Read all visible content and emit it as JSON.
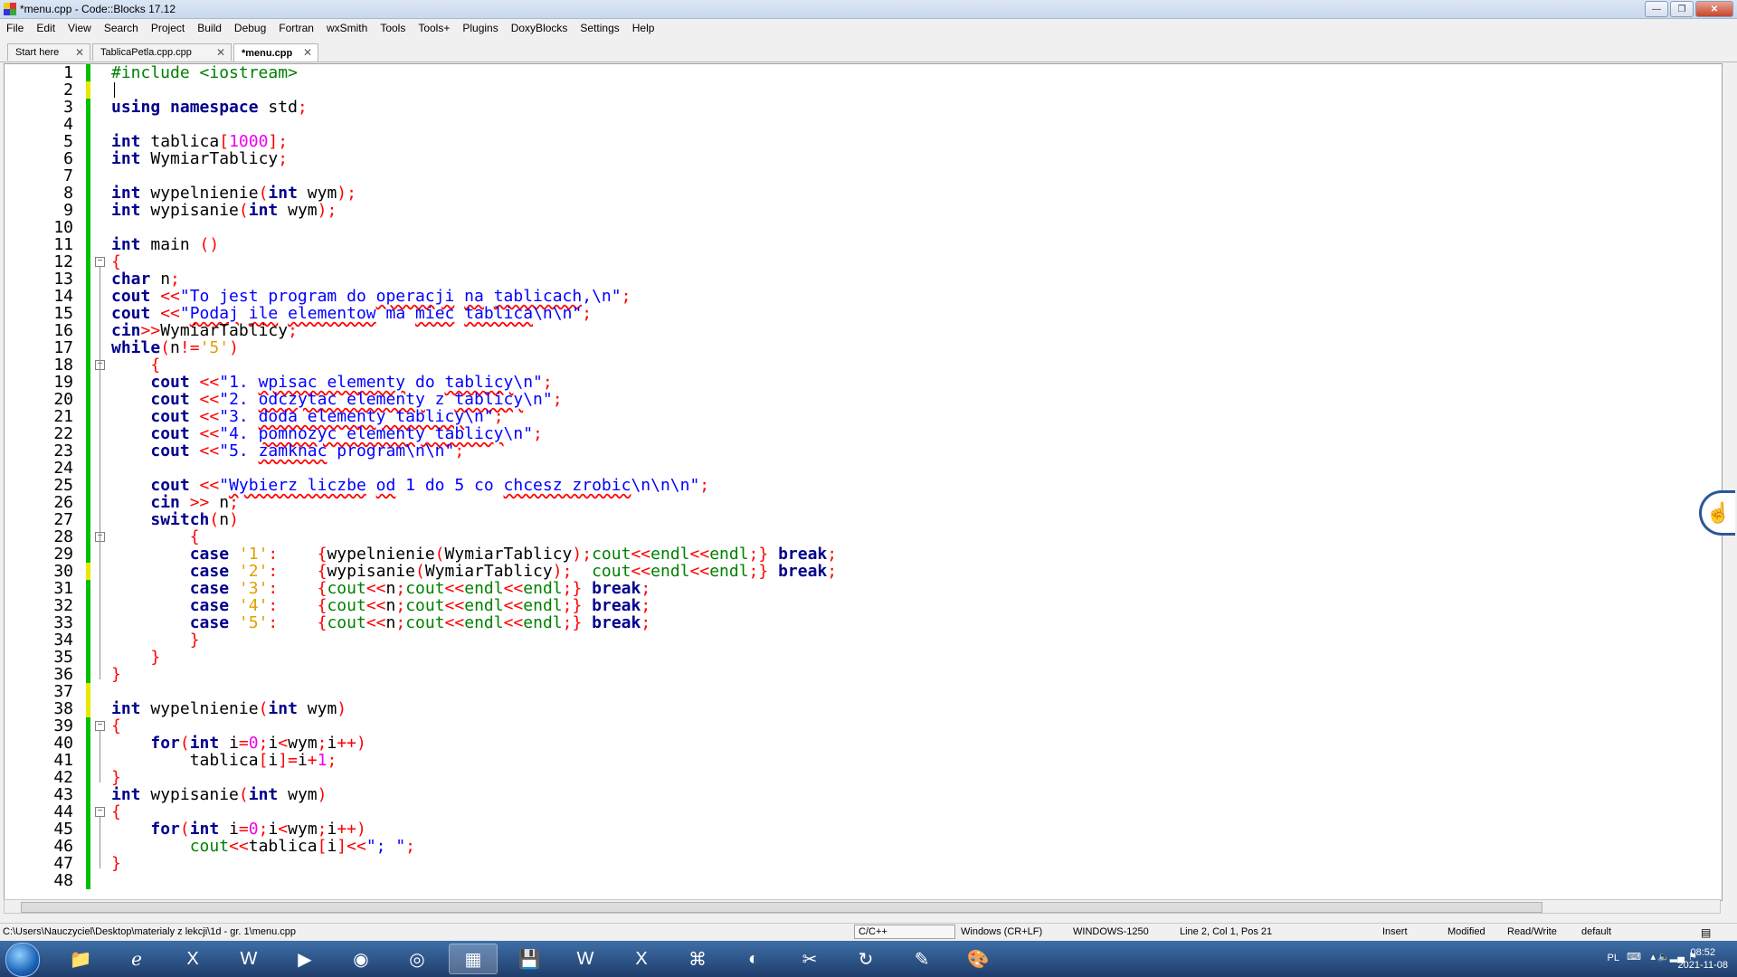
{
  "window": {
    "title": "*menu.cpp - Code::Blocks 17.12",
    "controls": {
      "minimize": "—",
      "maximize": "❐",
      "close": "✕"
    }
  },
  "menubar": [
    "File",
    "Edit",
    "View",
    "Search",
    "Project",
    "Build",
    "Debug",
    "Fortran",
    "wxSmith",
    "Tools",
    "Tools+",
    "Plugins",
    "DoxyBlocks",
    "Settings",
    "Help"
  ],
  "tabs": [
    {
      "label": "Start here",
      "active": false
    },
    {
      "label": "TablicaPetla.cpp.cpp",
      "active": false
    },
    {
      "label": "*menu.cpp",
      "active": true
    }
  ],
  "editor": {
    "line_numbers": [
      "1",
      "2",
      "3",
      "4",
      "5",
      "6",
      "7",
      "8",
      "9",
      "10",
      "11",
      "12",
      "13",
      "14",
      "15",
      "16",
      "17",
      "18",
      "19",
      "20",
      "21",
      "22",
      "23",
      "24",
      "25",
      "26",
      "27",
      "28",
      "29",
      "30",
      "31",
      "32",
      "33",
      "34",
      "35",
      "36",
      "37",
      "38",
      "39",
      "40",
      "41",
      "42",
      "43",
      "44",
      "45",
      "46",
      "47",
      "48"
    ],
    "lines": [
      [
        [
          "pp",
          "#include <iostream>"
        ]
      ],
      [],
      [
        [
          "kw",
          "using namespace "
        ],
        [
          "pl",
          "std"
        ],
        [
          "op",
          ";"
        ]
      ],
      [],
      [
        [
          "kw",
          "int "
        ],
        [
          "pl",
          "tablica"
        ],
        [
          "op",
          "["
        ],
        [
          "num",
          "1000"
        ],
        [
          "op",
          "];"
        ]
      ],
      [
        [
          "kw",
          "int "
        ],
        [
          "pl",
          "WymiarTablicy"
        ],
        [
          "op",
          ";"
        ]
      ],
      [],
      [
        [
          "kw",
          "int "
        ],
        [
          "pl",
          "wypelnienie"
        ],
        [
          "op",
          "("
        ],
        [
          "kw",
          "int "
        ],
        [
          "pl",
          "wym"
        ],
        [
          "op",
          ");"
        ]
      ],
      [
        [
          "kw",
          "int "
        ],
        [
          "pl",
          "wypisanie"
        ],
        [
          "op",
          "("
        ],
        [
          "kw",
          "int "
        ],
        [
          "pl",
          "wym"
        ],
        [
          "op",
          ");"
        ]
      ],
      [],
      [
        [
          "kw",
          "int "
        ],
        [
          "pl",
          "main "
        ],
        [
          "op",
          "()"
        ]
      ],
      [
        [
          "op",
          "{"
        ]
      ],
      [
        [
          "kw",
          "char "
        ],
        [
          "pl",
          "n"
        ],
        [
          "op",
          ";"
        ]
      ],
      [
        [
          "kw",
          "cout "
        ],
        [
          "op",
          "<<"
        ],
        [
          "str",
          "\"To jest program do "
        ],
        [
          "str sq",
          "operacji"
        ],
        [
          "str",
          " "
        ],
        [
          "str sq",
          "na"
        ],
        [
          "str",
          " "
        ],
        [
          "str sq",
          "tablicach"
        ],
        [
          "str",
          ",\\n\""
        ],
        [
          "op",
          ";"
        ]
      ],
      [
        [
          "kw",
          "cout "
        ],
        [
          "op",
          "<<"
        ],
        [
          "str",
          "\""
        ],
        [
          "str sq",
          "Podaj"
        ],
        [
          "str",
          " "
        ],
        [
          "str sq",
          "ile"
        ],
        [
          "str",
          " "
        ],
        [
          "str sq",
          "elementow"
        ],
        [
          "str",
          " ma "
        ],
        [
          "str sq",
          "miec"
        ],
        [
          "str",
          " "
        ],
        [
          "str sq",
          "tablica"
        ],
        [
          "str",
          "\\n\\n\""
        ],
        [
          "op",
          ";"
        ]
      ],
      [
        [
          "kw",
          "cin"
        ],
        [
          "op",
          ">>"
        ],
        [
          "pl",
          "WymiarTablicy"
        ],
        [
          "op",
          ";"
        ]
      ],
      [
        [
          "kw",
          "while"
        ],
        [
          "op",
          "("
        ],
        [
          "pl",
          "n"
        ],
        [
          "op",
          "!="
        ],
        [
          "chr",
          "'5'"
        ],
        [
          "op",
          ")"
        ]
      ],
      [
        [
          "pl",
          "    "
        ],
        [
          "op",
          "{"
        ]
      ],
      [
        [
          "pl",
          "    "
        ],
        [
          "kw",
          "cout "
        ],
        [
          "op",
          "<<"
        ],
        [
          "str",
          "\"1. "
        ],
        [
          "str sq",
          "wpisac elementy"
        ],
        [
          "str",
          " do "
        ],
        [
          "str sq",
          "tablicy"
        ],
        [
          "str",
          "\\n\""
        ],
        [
          "op",
          ";"
        ]
      ],
      [
        [
          "pl",
          "    "
        ],
        [
          "kw",
          "cout "
        ],
        [
          "op",
          "<<"
        ],
        [
          "str",
          "\"2. "
        ],
        [
          "str sq",
          "odczytac elementy"
        ],
        [
          "str",
          " z "
        ],
        [
          "str sq",
          "tablicy"
        ],
        [
          "str",
          "\\n\""
        ],
        [
          "op",
          ";"
        ]
      ],
      [
        [
          "pl",
          "    "
        ],
        [
          "kw",
          "cout "
        ],
        [
          "op",
          "<<"
        ],
        [
          "str",
          "\"3. "
        ],
        [
          "str sq",
          "doda elementy tablicy"
        ],
        [
          "str",
          "\\n\""
        ],
        [
          "op",
          ";"
        ]
      ],
      [
        [
          "pl",
          "    "
        ],
        [
          "kw",
          "cout "
        ],
        [
          "op",
          "<<"
        ],
        [
          "str",
          "\"4. "
        ],
        [
          "str sq",
          "pomnozyc elementy tablicy"
        ],
        [
          "str",
          "\\n\""
        ],
        [
          "op",
          ";"
        ]
      ],
      [
        [
          "pl",
          "    "
        ],
        [
          "kw",
          "cout "
        ],
        [
          "op",
          "<<"
        ],
        [
          "str",
          "\"5. "
        ],
        [
          "str sq",
          "zamknac"
        ],
        [
          "str",
          " program\\n\\n\""
        ],
        [
          "op",
          ";"
        ]
      ],
      [],
      [
        [
          "pl",
          "    "
        ],
        [
          "kw",
          "cout "
        ],
        [
          "op",
          "<<"
        ],
        [
          "str",
          "\""
        ],
        [
          "str sq",
          "Wybierz liczbe"
        ],
        [
          "str",
          " "
        ],
        [
          "str sq",
          "od"
        ],
        [
          "str",
          " 1 do 5 co "
        ],
        [
          "str sq",
          "chcesz zrobic"
        ],
        [
          "str",
          "\\n\\n\\n\""
        ],
        [
          "op",
          ";"
        ]
      ],
      [
        [
          "pl",
          "    "
        ],
        [
          "kw",
          "cin "
        ],
        [
          "op",
          ">> "
        ],
        [
          "pl",
          "n"
        ],
        [
          "op",
          ";"
        ]
      ],
      [
        [
          "pl",
          "    "
        ],
        [
          "kw",
          "switch"
        ],
        [
          "op",
          "("
        ],
        [
          "pl",
          "n"
        ],
        [
          "op",
          ")"
        ]
      ],
      [
        [
          "pl",
          "        "
        ],
        [
          "op",
          "{"
        ]
      ],
      [
        [
          "pl",
          "        "
        ],
        [
          "kw",
          "case "
        ],
        [
          "chr",
          "'1'"
        ],
        [
          "op",
          ":"
        ],
        [
          "pl",
          "    "
        ],
        [
          "op",
          "{"
        ],
        [
          "pl",
          "wypelnienie"
        ],
        [
          "op",
          "("
        ],
        [
          "pl",
          "WymiarTablicy"
        ],
        [
          "op",
          ");"
        ],
        [
          "pp",
          "cout"
        ],
        [
          "op",
          "<<"
        ],
        [
          "pp",
          "endl"
        ],
        [
          "op",
          "<<"
        ],
        [
          "pp",
          "endl"
        ],
        [
          "op",
          ";} "
        ],
        [
          "kw",
          "break"
        ],
        [
          "op",
          ";"
        ]
      ],
      [
        [
          "pl",
          "        "
        ],
        [
          "kw",
          "case "
        ],
        [
          "chr",
          "'2'"
        ],
        [
          "op",
          ":"
        ],
        [
          "pl",
          "    "
        ],
        [
          "op",
          "{"
        ],
        [
          "pl",
          "wypisanie"
        ],
        [
          "op",
          "("
        ],
        [
          "pl",
          "WymiarTablicy"
        ],
        [
          "op",
          ");  "
        ],
        [
          "pp",
          "cout"
        ],
        [
          "op",
          "<<"
        ],
        [
          "pp",
          "endl"
        ],
        [
          "op",
          "<<"
        ],
        [
          "pp",
          "endl"
        ],
        [
          "op",
          ";} "
        ],
        [
          "kw",
          "break"
        ],
        [
          "op",
          ";"
        ]
      ],
      [
        [
          "pl",
          "        "
        ],
        [
          "kw",
          "case "
        ],
        [
          "chr",
          "'3'"
        ],
        [
          "op",
          ":"
        ],
        [
          "pl",
          "    "
        ],
        [
          "op",
          "{"
        ],
        [
          "pp",
          "cout"
        ],
        [
          "op",
          "<<"
        ],
        [
          "pl",
          "n"
        ],
        [
          "op",
          ";"
        ],
        [
          "pp",
          "cout"
        ],
        [
          "op",
          "<<"
        ],
        [
          "pp",
          "endl"
        ],
        [
          "op",
          "<<"
        ],
        [
          "pp",
          "endl"
        ],
        [
          "op",
          ";} "
        ],
        [
          "kw",
          "break"
        ],
        [
          "op",
          ";"
        ]
      ],
      [
        [
          "pl",
          "        "
        ],
        [
          "kw",
          "case "
        ],
        [
          "chr",
          "'4'"
        ],
        [
          "op",
          ":"
        ],
        [
          "pl",
          "    "
        ],
        [
          "op",
          "{"
        ],
        [
          "pp",
          "cout"
        ],
        [
          "op",
          "<<"
        ],
        [
          "pl",
          "n"
        ],
        [
          "op",
          ";"
        ],
        [
          "pp",
          "cout"
        ],
        [
          "op",
          "<<"
        ],
        [
          "pp",
          "endl"
        ],
        [
          "op",
          "<<"
        ],
        [
          "pp",
          "endl"
        ],
        [
          "op",
          ";} "
        ],
        [
          "kw",
          "break"
        ],
        [
          "op",
          ";"
        ]
      ],
      [
        [
          "pl",
          "        "
        ],
        [
          "kw",
          "case "
        ],
        [
          "chr",
          "'5'"
        ],
        [
          "op",
          ":"
        ],
        [
          "pl",
          "    "
        ],
        [
          "op",
          "{"
        ],
        [
          "pp",
          "cout"
        ],
        [
          "op",
          "<<"
        ],
        [
          "pl",
          "n"
        ],
        [
          "op",
          ";"
        ],
        [
          "pp",
          "cout"
        ],
        [
          "op",
          "<<"
        ],
        [
          "pp",
          "endl"
        ],
        [
          "op",
          "<<"
        ],
        [
          "pp",
          "endl"
        ],
        [
          "op",
          ";} "
        ],
        [
          "kw",
          "break"
        ],
        [
          "op",
          ";"
        ]
      ],
      [
        [
          "pl",
          "        "
        ],
        [
          "op",
          "}"
        ]
      ],
      [
        [
          "pl",
          "    "
        ],
        [
          "op",
          "}"
        ]
      ],
      [
        [
          "op",
          "}"
        ]
      ],
      [],
      [
        [
          "kw",
          "int "
        ],
        [
          "pl",
          "wypelnienie"
        ],
        [
          "op",
          "("
        ],
        [
          "kw",
          "int "
        ],
        [
          "pl",
          "wym"
        ],
        [
          "op",
          ")"
        ]
      ],
      [
        [
          "op",
          "{"
        ]
      ],
      [
        [
          "pl",
          "    "
        ],
        [
          "kw",
          "for"
        ],
        [
          "op",
          "("
        ],
        [
          "kw",
          "int "
        ],
        [
          "pl",
          "i"
        ],
        [
          "op",
          "="
        ],
        [
          "num",
          "0"
        ],
        [
          "op",
          ";"
        ],
        [
          "pl",
          "i"
        ],
        [
          "op",
          "<"
        ],
        [
          "pl",
          "wym"
        ],
        [
          "op",
          ";"
        ],
        [
          "pl",
          "i"
        ],
        [
          "op",
          "++)"
        ]
      ],
      [
        [
          "pl",
          "        tablica"
        ],
        [
          "op",
          "["
        ],
        [
          "pl",
          "i"
        ],
        [
          "op",
          "]="
        ],
        [
          "pl",
          "i"
        ],
        [
          "op",
          "+"
        ],
        [
          "num",
          "1"
        ],
        [
          "op",
          ";"
        ]
      ],
      [
        [
          "op",
          "}"
        ]
      ],
      [
        [
          "kw",
          "int "
        ],
        [
          "pl",
          "wypisanie"
        ],
        [
          "op",
          "("
        ],
        [
          "kw",
          "int "
        ],
        [
          "pl",
          "wym"
        ],
        [
          "op",
          ")"
        ]
      ],
      [
        [
          "op",
          "{"
        ]
      ],
      [
        [
          "pl",
          "    "
        ],
        [
          "kw",
          "for"
        ],
        [
          "op",
          "("
        ],
        [
          "kw",
          "int "
        ],
        [
          "pl",
          "i"
        ],
        [
          "op",
          "="
        ],
        [
          "num",
          "0"
        ],
        [
          "op",
          ";"
        ],
        [
          "pl",
          "i"
        ],
        [
          "op",
          "<"
        ],
        [
          "pl",
          "wym"
        ],
        [
          "op",
          ";"
        ],
        [
          "pl",
          "i"
        ],
        [
          "op",
          "++)"
        ]
      ],
      [
        [
          "pl",
          "        "
        ],
        [
          "pp",
          "cout"
        ],
        [
          "op",
          "<<"
        ],
        [
          "pl",
          "tablica"
        ],
        [
          "op",
          "["
        ],
        [
          "pl",
          "i"
        ],
        [
          "op",
          "]<<"
        ],
        [
          "str",
          "\"; \""
        ],
        [
          "op",
          ";"
        ]
      ],
      [
        [
          "op",
          "}"
        ]
      ],
      []
    ]
  },
  "statusbar": {
    "path": "C:\\Users\\Nauczyciel\\Desktop\\materialy z lekcji\\1d - gr. 1\\menu.cpp",
    "language": "C/C++",
    "eol": "Windows (CR+LF)",
    "encoding": "WINDOWS-1250",
    "position": "Line 2, Col 1, Pos 21",
    "mode": "Insert",
    "modified": "Modified",
    "access": "Read/Write",
    "profile": "default"
  },
  "taskbar": {
    "lang": "PL",
    "time": "08:52",
    "date": "2021-11-08"
  },
  "colors": {
    "keyword": "#00008b",
    "preprocessor": "#008000",
    "number": "#f000f0",
    "string": "#0000ff",
    "char": "#e0a000",
    "operator": "#ff0000",
    "changed_saved": "#00c000",
    "changed_unsaved": "#e8e800"
  }
}
